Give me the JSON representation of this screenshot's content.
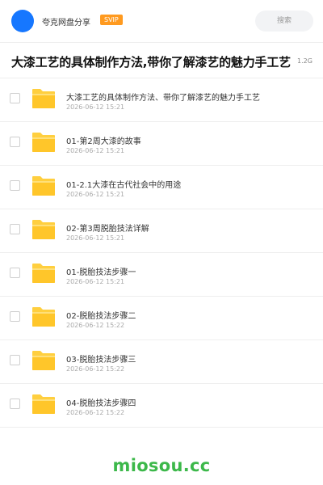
{
  "header": {
    "site_name": "夸克网盘分享",
    "badge": "SVIP",
    "search_placeholder": "搜索"
  },
  "page": {
    "title": "大漆工艺的具体制作方法,带你了解漆艺的魅力手工艺",
    "total_size": "1.2G"
  },
  "files": [
    {
      "name": "大漆工艺的具体制作方法、带你了解漆艺的魅力手工艺",
      "date": "2026-06-12 15:21",
      "icon": "folder-icon"
    },
    {
      "name": "01-第2周大漆的故事",
      "date": "2026-06-12 15:21",
      "icon": "folder-icon"
    },
    {
      "name": "01-2.1大漆在古代社会中的用途",
      "date": "2026-06-12 15:21",
      "icon": "folder-icon"
    },
    {
      "name": "02-第3周脱胎技法详解",
      "date": "2026-06-12 15:21",
      "icon": "folder-icon"
    },
    {
      "name": "01-脱胎技法步骤一",
      "date": "2026-06-12 15:21",
      "icon": "folder-icon"
    },
    {
      "name": "02-脱胎技法步骤二",
      "date": "2026-06-12 15:22",
      "icon": "folder-icon"
    },
    {
      "name": "03-脱胎技法步骤三",
      "date": "2026-06-12 15:22",
      "icon": "folder-icon"
    },
    {
      "name": "04-脱胎技法步骤四",
      "date": "2026-06-12 15:22",
      "icon": "folder-icon"
    }
  ],
  "watermark": "miosou.cc",
  "colors": {
    "accent": "#1677ff",
    "badge": "#ff9a1f",
    "folder": "#ffc62a",
    "watermark": "#3cb84a"
  }
}
